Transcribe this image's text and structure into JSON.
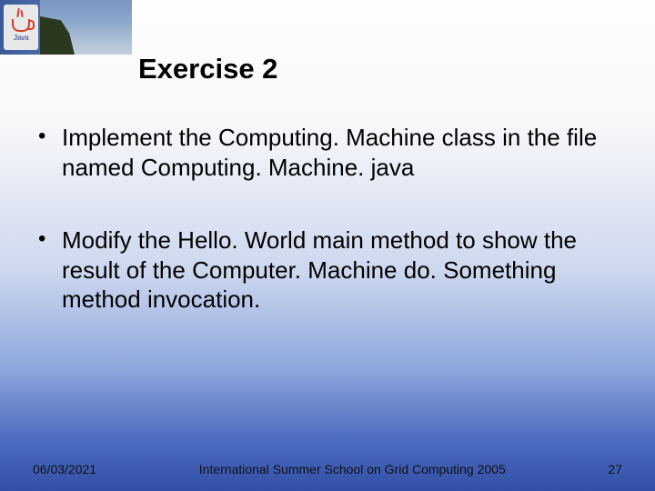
{
  "header": {
    "logo_text": "Java"
  },
  "title": "Exercise 2",
  "bullets": [
    "Implement the Computing. Machine class in the file named Computing. Machine. java",
    "Modify the Hello. World main method to show the result of the Computer. Machine do. Something method invocation."
  ],
  "footer": {
    "date": "06/03/2021",
    "venue": "International Summer School on Grid Computing 2005",
    "page": "27"
  }
}
